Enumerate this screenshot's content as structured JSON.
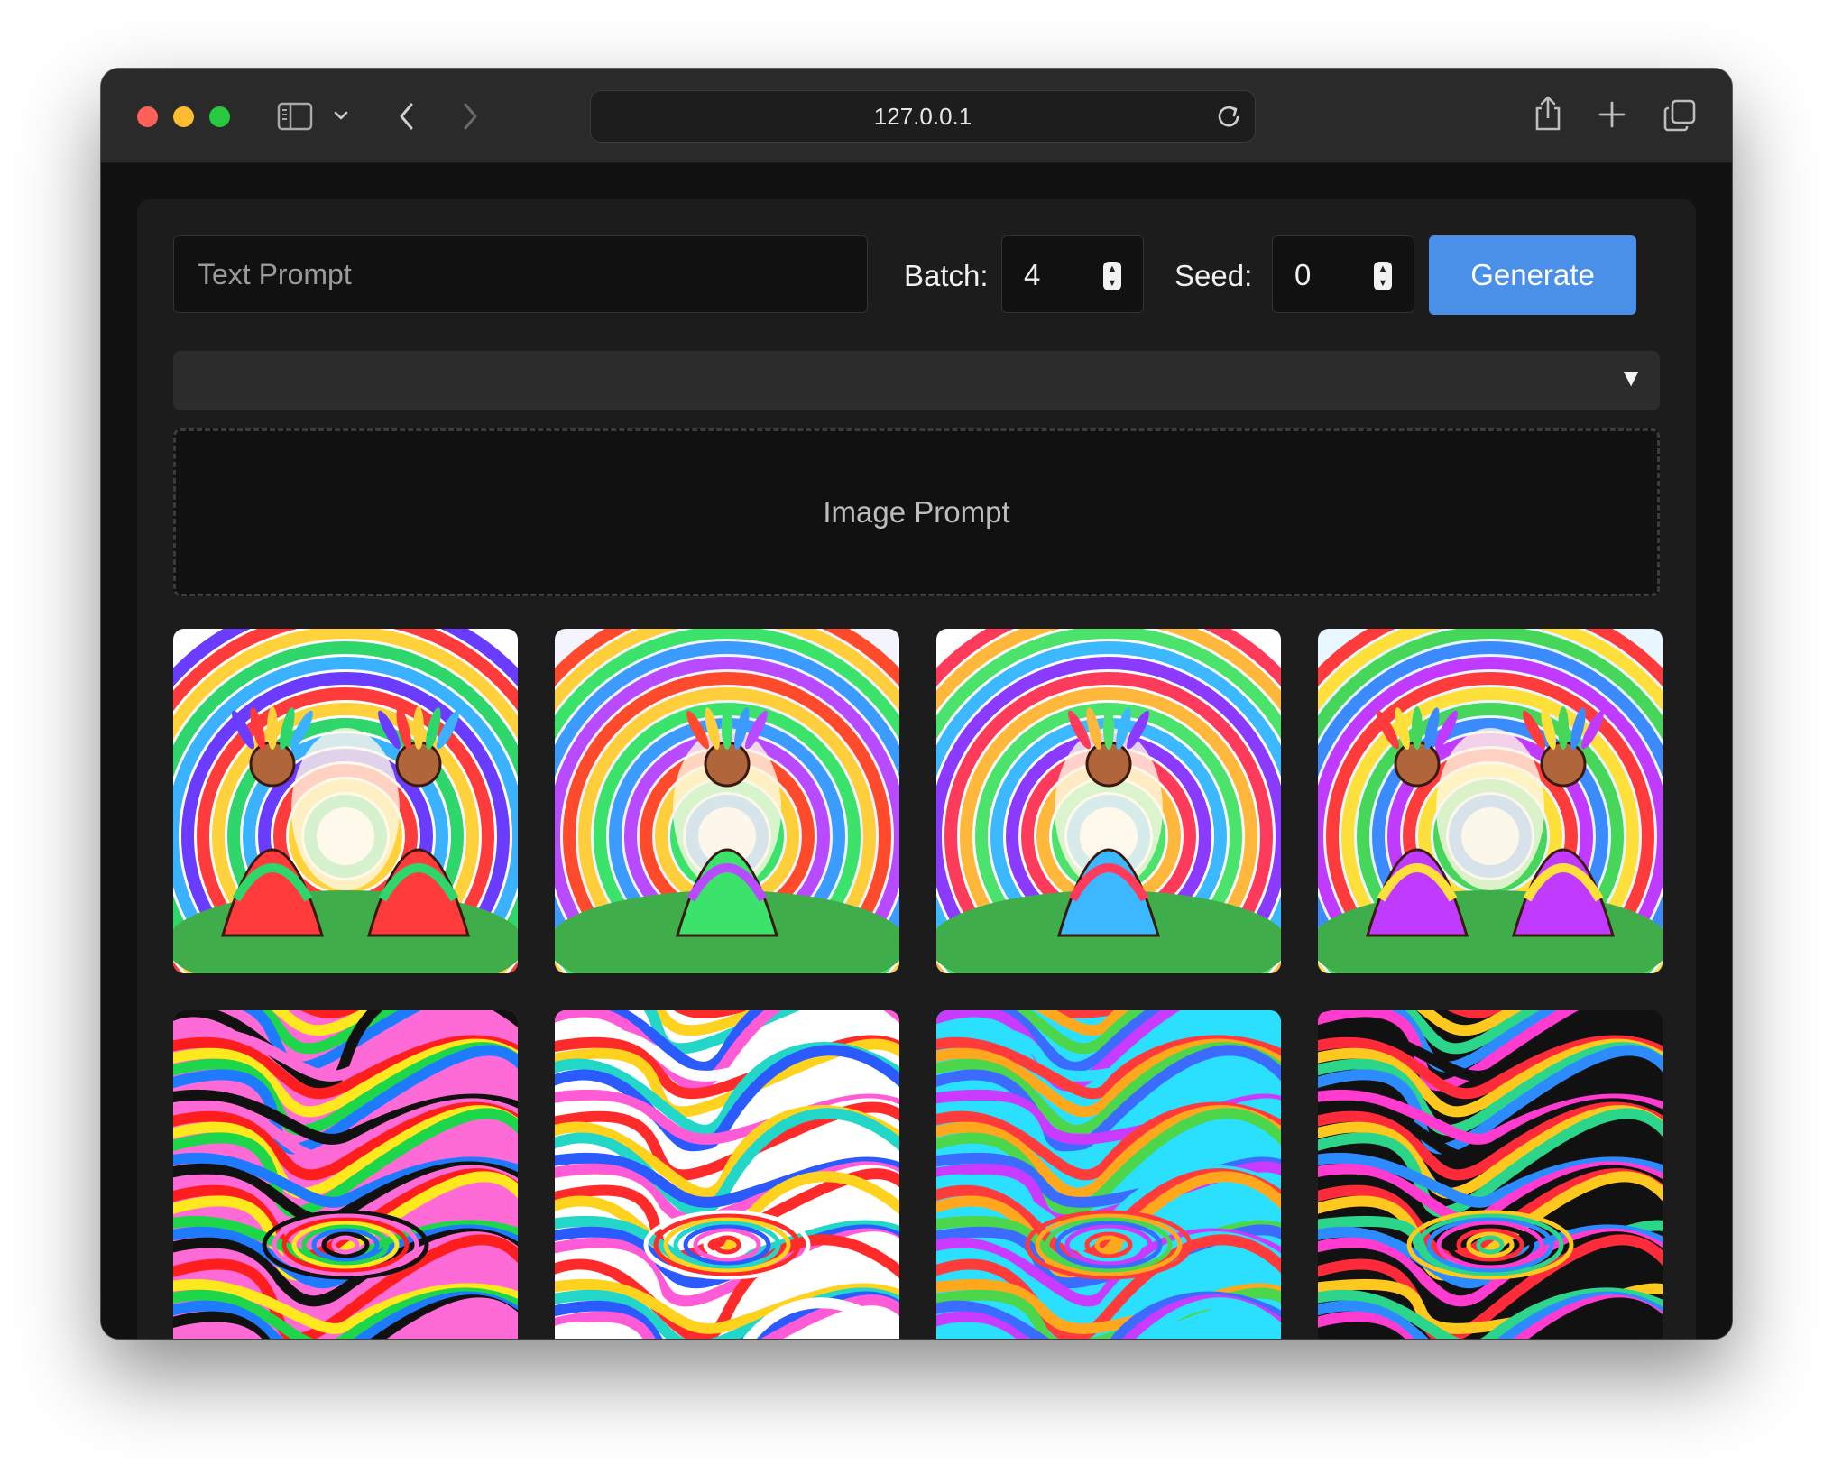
{
  "browser": {
    "url": "127.0.0.1",
    "icons": [
      "sidebar-icon",
      "chevron-down-icon",
      "back-icon",
      "forward-icon",
      "reload-icon",
      "share-icon",
      "new-tab-icon",
      "tabs-overview-icon"
    ]
  },
  "form": {
    "text_prompt_placeholder": "Text Prompt",
    "text_prompt_value": "",
    "batch_label": "Batch:",
    "batch_value": "4",
    "seed_label": "Seed:",
    "seed_value": "0",
    "generate_label": "Generate",
    "dropdown_selected": "",
    "dropdown_arrow": "▼",
    "image_prompt_label": "Image Prompt"
  },
  "colors": {
    "accent": "#4a8fe8",
    "panel": "#1c1c1c",
    "background": "#111111"
  },
  "images": [
    {
      "subject": "two shamans around a glowing chalice under rainbow arches",
      "palette": [
        "#6a3cff",
        "#ff3b3b",
        "#ffd23b",
        "#2ed66b",
        "#3bb2ff",
        "#ffffff"
      ]
    },
    {
      "subject": "shaman with feathered headdress meditating among rainbows",
      "palette": [
        "#ff4b2b",
        "#ffcf3b",
        "#3ce36b",
        "#3b9bff",
        "#b84bff",
        "#f4f4ff"
      ]
    },
    {
      "subject": "woman with feathers holding a candle beside a waterfall",
      "palette": [
        "#ff3b5c",
        "#ffb83b",
        "#4be36b",
        "#3bb8ff",
        "#8a3bff",
        "#ffffff"
      ]
    },
    {
      "subject": "two elders in headdresses facing each other over a glowing bowl",
      "palette": [
        "#ff3b3b",
        "#ffe03b",
        "#46d65a",
        "#3b8bff",
        "#c03bff",
        "#e8f6ff"
      ]
    },
    {
      "subject": "psychedelic swirling pattern",
      "palette": [
        "#ff1e1e",
        "#ffe81e",
        "#1ed64a",
        "#1e7bff",
        "#111111",
        "#ff6bd6"
      ]
    },
    {
      "subject": "psychedelic liquid ripple pattern",
      "palette": [
        "#ff2b2b",
        "#ffd21e",
        "#22d6c8",
        "#2b5bff",
        "#ff5bd6",
        "#ffffff"
      ]
    },
    {
      "subject": "psychedelic symmetric tunnel pattern",
      "palette": [
        "#ff3b3b",
        "#ffa81e",
        "#4bd64b",
        "#3b6bff",
        "#c93bff",
        "#2be0ff"
      ]
    },
    {
      "subject": "psychedelic vortex reflection pattern",
      "palette": [
        "#ff2b3b",
        "#ffc81e",
        "#2bd68a",
        "#2b8bff",
        "#ff3bd0",
        "#111111"
      ]
    }
  ]
}
